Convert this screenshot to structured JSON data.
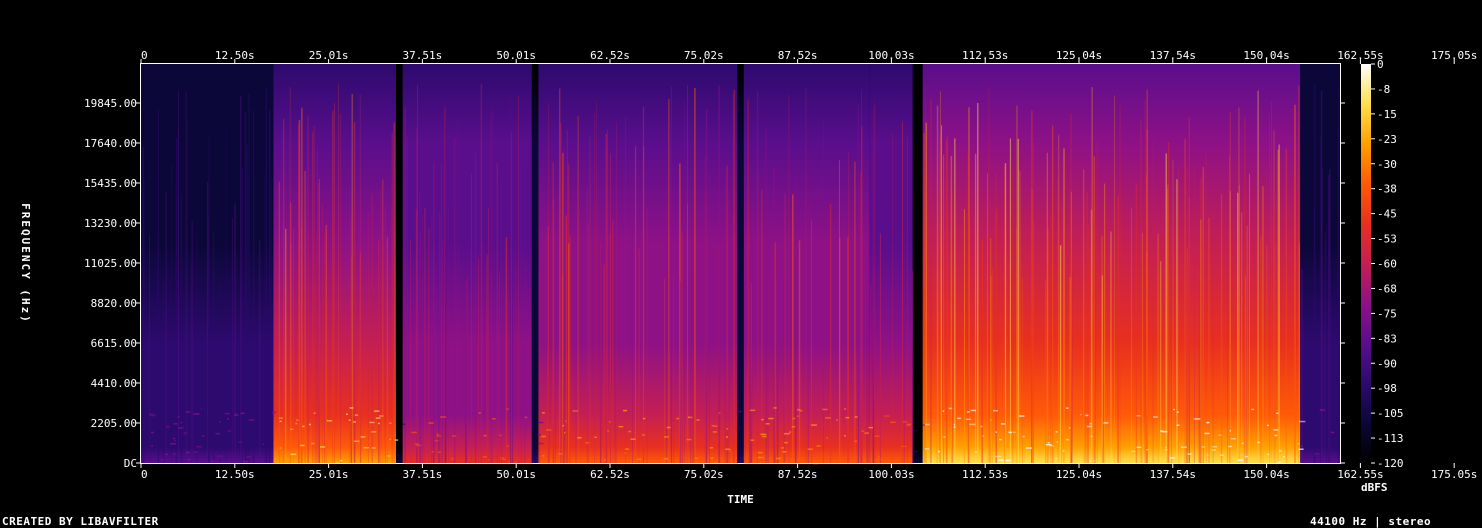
{
  "chart_data": {
    "type": "heatmap",
    "xlabel": "TIME",
    "ylabel": "FREQUENCY (Hz)",
    "x_ticks": [
      "0",
      "12.50s",
      "25.01s",
      "37.51s",
      "50.01s",
      "62.52s",
      "75.02s",
      "87.52s",
      "100.03s",
      "112.53s",
      "125.04s",
      "137.54s",
      "150.04s",
      "162.55s",
      "175.05s"
    ],
    "y_ticks": [
      "DC",
      "2205.00",
      "4410.00",
      "6615.00",
      "8820.00",
      "11025.00",
      "13230.00",
      "15435.00",
      "17640.00",
      "19845.00"
    ],
    "colorbar_label": "dBFS",
    "colorbar_ticks": [
      "0",
      "-8",
      "-15",
      "-23",
      "-30",
      "-38",
      "-45",
      "-53",
      "-60",
      "-68",
      "-75",
      "-83",
      "-90",
      "-98",
      "-105",
      "-113",
      "-120"
    ],
    "colorbar_range": [
      -120,
      0
    ],
    "x_range": [
      0,
      181
    ],
    "y_range": [
      0,
      22050
    ],
    "colormap": [
      "#000000",
      "#0b0738",
      "#2d0a6e",
      "#5a0e8c",
      "#8e1186",
      "#c41f53",
      "#e8301f",
      "#ff5a08",
      "#ffa000",
      "#ffe04d",
      "#ffffff"
    ],
    "segments": [
      {
        "start": 0,
        "end": 20.0,
        "level": 0.25
      },
      {
        "start": 20.0,
        "end": 38.5,
        "level": 0.72
      },
      {
        "start": 38.5,
        "end": 39.5,
        "level": 0.05
      },
      {
        "start": 39.5,
        "end": 59.0,
        "level": 0.55
      },
      {
        "start": 59.0,
        "end": 60.0,
        "level": 0.15
      },
      {
        "start": 60.0,
        "end": 90.0,
        "level": 0.65
      },
      {
        "start": 90.0,
        "end": 91.0,
        "level": 0.15
      },
      {
        "start": 91.0,
        "end": 110.0,
        "level": 0.62
      },
      {
        "start": 110.0,
        "end": 116.5,
        "level": 0.58
      },
      {
        "start": 116.5,
        "end": 118.0,
        "level": 0.05
      },
      {
        "start": 118.0,
        "end": 175.0,
        "level": 0.85
      },
      {
        "start": 175.0,
        "end": 181.0,
        "level": 0.25
      }
    ]
  },
  "footer": {
    "left": "CREATED BY LIBAVFILTER",
    "right": "44100 Hz | stereo"
  }
}
